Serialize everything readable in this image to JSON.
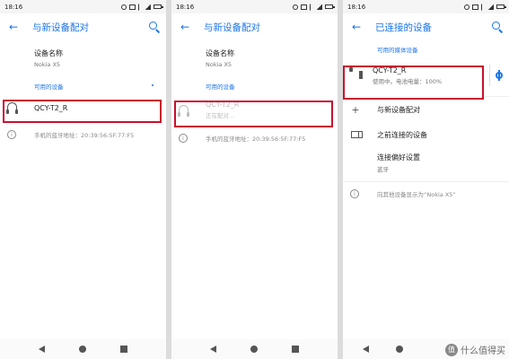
{
  "status": {
    "time": "18:16"
  },
  "panel1": {
    "title": "与新设备配对",
    "device_name_label": "设备名称",
    "device_name_value": "Nokia X5",
    "available_section": "可用的设备",
    "device": {
      "name": "QCY-T2_R"
    },
    "bt_address": "手机的蓝牙地址：20:39:56:5F:77:F5"
  },
  "panel2": {
    "title": "与新设备配对",
    "device_name_label": "设备名称",
    "device_name_value": "Nokia X5",
    "available_section": "可用的设备",
    "device": {
      "name": "QCY-T2_R",
      "status": "正在配对…"
    },
    "bt_address": "手机的蓝牙地址：20:39:56:5F:77:F5"
  },
  "panel3": {
    "title": "已连接的设备",
    "media_section": "可用的媒体设备",
    "device": {
      "name": "QCY-T2_R",
      "status": "使用中。电池电量：100%"
    },
    "pair_new": "与新设备配对",
    "previous": "之前连接的设备",
    "prefs_label": "连接偏好设置",
    "prefs_sub": "蓝牙",
    "visible_text": "向其他设备显示为“Nokia X5”"
  },
  "watermark": {
    "badge": "值",
    "text": "什么值得买"
  },
  "colors": {
    "accent": "#1a73e8",
    "highlight": "#c8102e"
  }
}
